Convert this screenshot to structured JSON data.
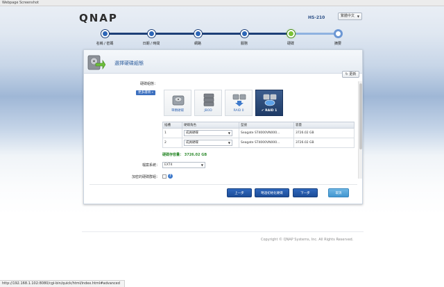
{
  "window": {
    "title": "Webpage Screenshot"
  },
  "header": {
    "logo": "QNAP",
    "model": "HS-210",
    "language": "繁體中文"
  },
  "wizard": {
    "steps": [
      {
        "label": "名稱 / 密碼",
        "state": "done"
      },
      {
        "label": "日期 / 時間",
        "state": "done"
      },
      {
        "label": "網路",
        "state": "done"
      },
      {
        "label": "服務",
        "state": "done"
      },
      {
        "label": "硬碟",
        "state": "current"
      },
      {
        "label": "摘要",
        "state": "future"
      }
    ]
  },
  "panel": {
    "title": "選擇硬碟組態",
    "refresh_label": "更新",
    "config_label": "硬碟組態：",
    "more_options": "更多選項 »",
    "configs": [
      {
        "label": "單顆硬碟",
        "icon": "single-disk-icon",
        "selected": false
      },
      {
        "label": "JBOD",
        "icon": "jbod-icon",
        "selected": false
      },
      {
        "label": "RAID 0",
        "icon": "raid0-icon",
        "selected": false
      },
      {
        "label": "RAID 1",
        "icon": "raid1-icon",
        "selected": true
      }
    ],
    "table": {
      "headers": [
        "插槽",
        "硬碟角色",
        "型號",
        "容量"
      ],
      "rows": [
        {
          "slot": "1",
          "role": "成員硬碟",
          "model": "Seagate ST4000VN000...",
          "capacity": "3726.02 GB"
        },
        {
          "slot": "2",
          "role": "成員硬碟",
          "model": "Seagate ST4000VN000...",
          "capacity": "3726.02 GB"
        }
      ]
    },
    "capacity_text": "硬碟存容量： 3726.02 GB",
    "fs_label": "檔案系統：",
    "fs_value": "EXT4",
    "encrypt_label": "加密的硬碟群組：",
    "buttons": {
      "prev": "上一步",
      "init_disks": "略過初始化硬碟",
      "next": "下一步",
      "cancel": "取消"
    }
  },
  "footer": {
    "copyright": "Copyright © QNAP Systems, Inc. All Rights Reserved."
  },
  "statusbar": {
    "url": "http://192.168.1.102:8080/cgi-bin/quick/html/index.html#advanced"
  },
  "colors": {
    "accent": "#2d66b7",
    "current_step": "#7ac235",
    "capacity_green": "#2d8a2d"
  }
}
